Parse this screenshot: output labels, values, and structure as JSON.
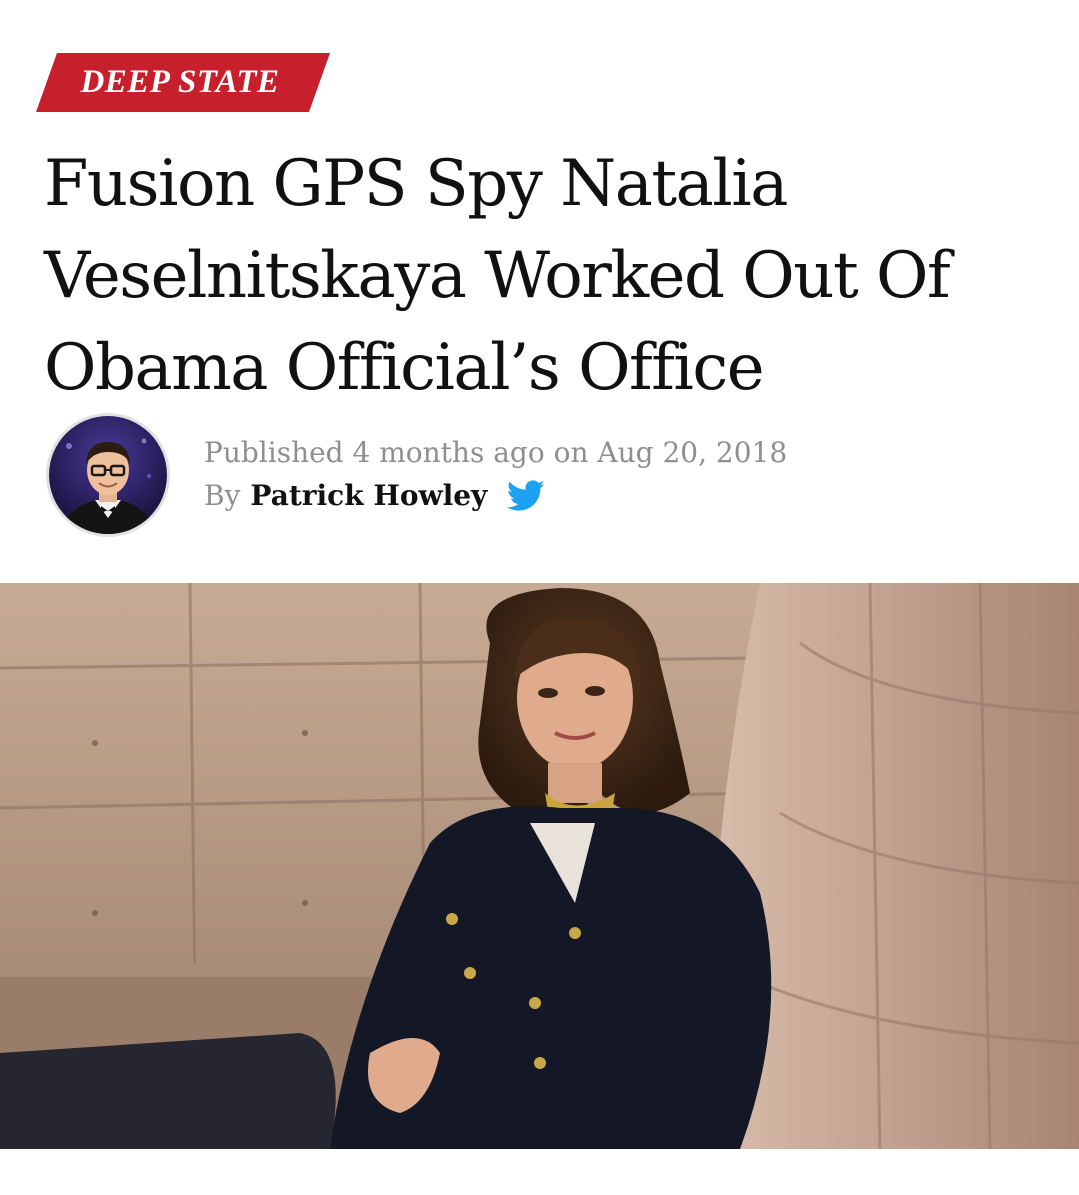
{
  "category": {
    "label": "DEEP STATE",
    "color": "#c7202c"
  },
  "article": {
    "headline": "Fusion GPS Spy Natalia Veselnitskaya Worked Out Of Obama Official’s Office",
    "published_prefix": "Published",
    "published_relative": "4 months ago",
    "published_on": "on",
    "published_date": "Aug 20, 2018",
    "by_label": "By",
    "author": "Patrick Howley",
    "author_icon": "twitter-bird-icon",
    "twitter_color": "#1da1f2"
  },
  "media": {
    "avatar": "author-avatar-photo",
    "hero": "hero-photo-woman-on-sofa"
  }
}
